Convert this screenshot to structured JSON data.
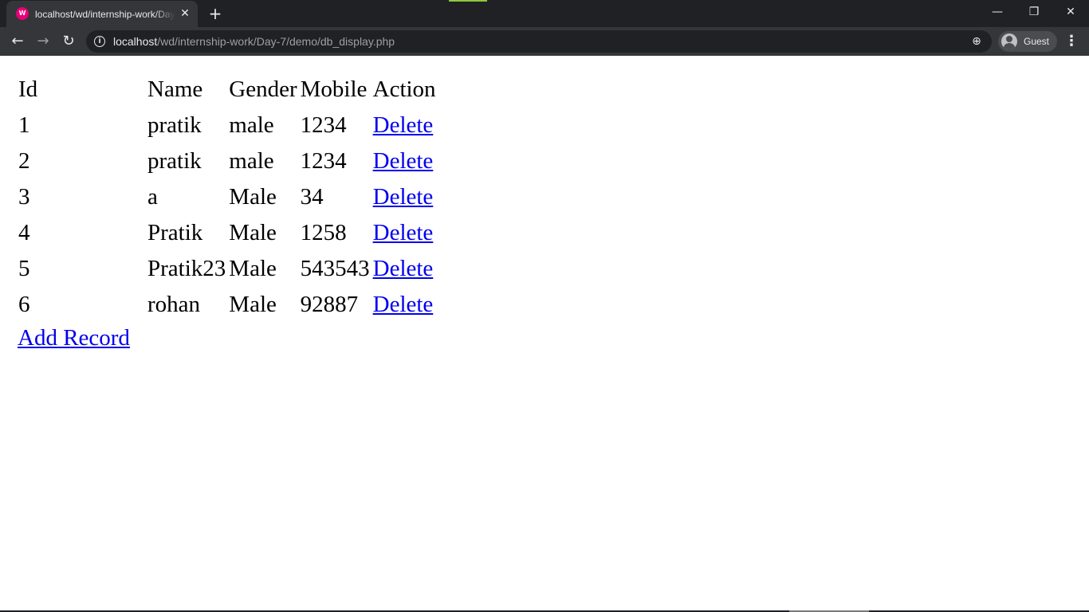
{
  "browser": {
    "tab_title": "localhost/wd/internship-work/Day-7/demo/db_display.php",
    "url_host": "localhost",
    "url_path": "/wd/internship-work/Day-7/demo/db_display.php",
    "profile_label": "Guest"
  },
  "table": {
    "headers": [
      "Id",
      "Name",
      "Gender",
      "Mobile",
      "Action"
    ],
    "rows": [
      {
        "id": "1",
        "name": "pratik",
        "gender": "male",
        "mobile": "1234",
        "action": "Delete"
      },
      {
        "id": "2",
        "name": "pratik",
        "gender": "male",
        "mobile": "1234",
        "action": "Delete"
      },
      {
        "id": "3",
        "name": "a",
        "gender": "Male",
        "mobile": "34",
        "action": "Delete"
      },
      {
        "id": "4",
        "name": "Pratik",
        "gender": "Male",
        "mobile": "1258",
        "action": "Delete"
      },
      {
        "id": "5",
        "name": "Pratik23",
        "gender": "Male",
        "mobile": "543543",
        "action": "Delete"
      },
      {
        "id": "6",
        "name": "rohan",
        "gender": "Male",
        "mobile": "92887",
        "action": "Delete"
      }
    ]
  },
  "add_record_label": "Add Record"
}
